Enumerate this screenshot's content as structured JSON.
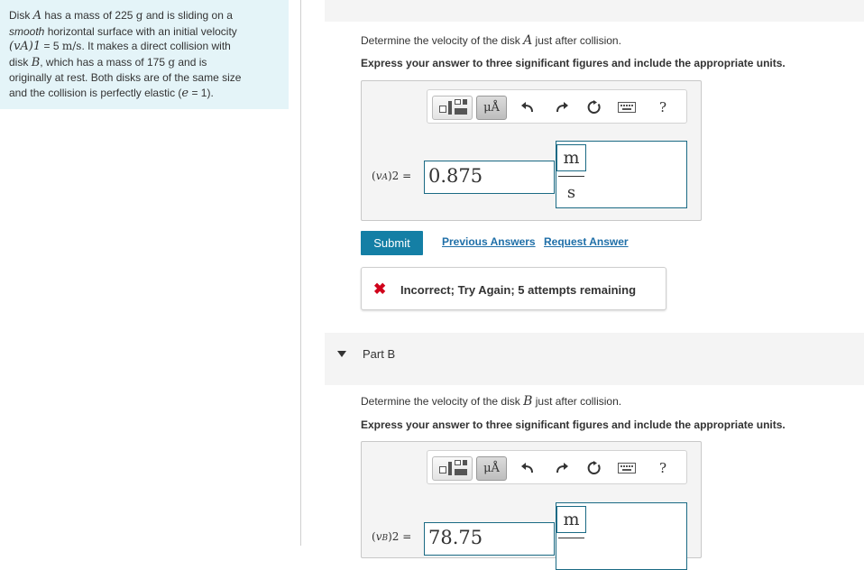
{
  "problem": {
    "t1": "Disk ",
    "diskA": "A",
    "t2": " has a mass of 225 ",
    "unit_g1": "g",
    "t3": " and is sliding on a",
    "t4_ital": "smooth",
    "t5": " horizontal surface with an initial velocity",
    "v_sym": "(vA)1",
    "t6": " = 5 ",
    "unit_ms": "m/s",
    "t7": ". It makes a direct collision with",
    "t8": "disk ",
    "diskB": "B",
    "t9": ", which has a mass of 175 ",
    "unit_g2": "g",
    "t10": " and is",
    "t11": "originally at rest. Both disks are of the same size",
    "t12": "and the collision is perfectly elastic (",
    "e_sym": "e",
    "t13": " = 1)."
  },
  "part_a": {
    "q_pre": "Determine the velocity of the disk ",
    "q_disk": "A",
    "q_post": " just after collision.",
    "instruction": "Express your answer to three significant figures and include the appropriate units.",
    "var_prefix": "(",
    "var_v": "v",
    "var_sub": "A",
    "var_suffix": ")2 =",
    "value": "0.875",
    "unit_num": "m",
    "unit_den": "s"
  },
  "toolbar": {
    "units_label": "μÅ",
    "help_label": "?"
  },
  "actions": {
    "submit": "Submit",
    "previous_answers": "Previous Answers",
    "request_answer": "Request Answer"
  },
  "feedback": {
    "icon": "✖",
    "message": "Incorrect; Try Again; 5 attempts remaining"
  },
  "part_b": {
    "title": "Part B",
    "q_pre": "Determine the velocity of the disk ",
    "q_disk": "B",
    "q_post": " just after collision.",
    "instruction": "Express your answer to three significant figures and include the appropriate units.",
    "var_prefix": "(",
    "var_v": "v",
    "var_sub": "B",
    "var_suffix": ")2 =",
    "value": "78.75",
    "unit_num": "m"
  },
  "colors": {
    "problem_bg": "#e4f4f8",
    "accent": "#147fa5",
    "link": "#1f6fa8",
    "error": "#d0021b"
  }
}
